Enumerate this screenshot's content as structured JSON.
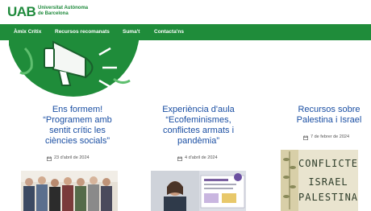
{
  "header": {
    "logo_mark": "UAB",
    "logo_line1": "Universitat Autònoma",
    "logo_line2": "de Barcelona"
  },
  "nav": {
    "items": [
      {
        "label": "Àmix Crítix"
      },
      {
        "label": "Recursos recomanats"
      },
      {
        "label": "Suma't"
      },
      {
        "label": "Contacta'ns"
      }
    ]
  },
  "colors": {
    "brand_green": "#1f8c3a",
    "title_blue": "#1b4fa3"
  },
  "cards": [
    {
      "title_lines": [
        "Ens formem!",
        "“Programem amb",
        "sentit crític les",
        "ciències socials”"
      ],
      "date": "23 d'abril de 2024",
      "icon": "calendar-icon"
    },
    {
      "title_lines": [
        "Experiència d'aula",
        "“Ecofeminismes,",
        "conflictes armats i",
        "pandèmia”"
      ],
      "date": "4 d'abril de 2024",
      "icon": "calendar-icon"
    },
    {
      "title_lines": [
        "Recursos sobre",
        "Palestina i Israel"
      ],
      "date": "7 de febrer de 2024",
      "icon": "calendar-icon"
    }
  ],
  "book_cover": {
    "line1": "CONFLICTE",
    "line2": "ISRAEL",
    "line3": "PALESTINA"
  }
}
